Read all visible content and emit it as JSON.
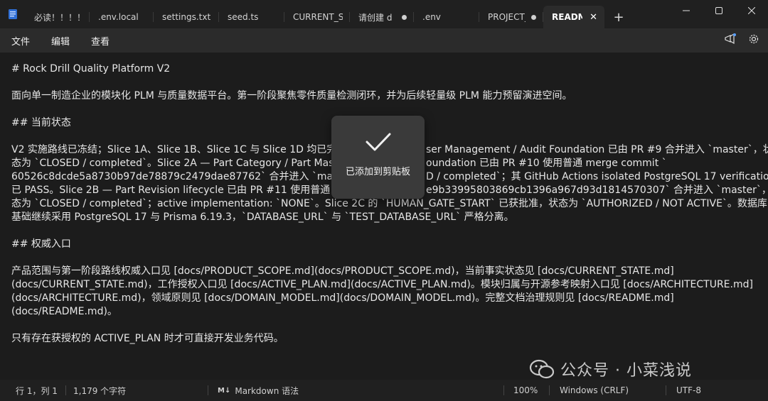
{
  "tabs": [
    {
      "label": "必读！！！！",
      "modified": false
    },
    {
      "label": ".env.local",
      "modified": false
    },
    {
      "label": "settings.txt",
      "modified": false
    },
    {
      "label": "seed.ts",
      "modified": false
    },
    {
      "label": "CURRENT_STAT",
      "modified": false
    },
    {
      "label": "请创建 d",
      "modified": true
    },
    {
      "label": ".env",
      "modified": false
    },
    {
      "label": "PROJECT_",
      "modified": true
    },
    {
      "label": "READMI",
      "active": true
    }
  ],
  "tab_close": "✕",
  "new_tab": "+",
  "menu": {
    "file": "文件",
    "edit": "编辑",
    "view": "查看"
  },
  "doc": {
    "lines": [
      "# Rock Drill Quality Platform V2",
      "",
      "面向单一制造企业的模块化 PLM 与质量数据平台。第一阶段聚焦零件质量检测闭环，并为后续轻量级 PLM 能力预留演进空间。",
      "",
      "## 当前状态",
      "",
      "V2 实施路线已冻结；Slice 1A、Slice 1B、Slice 1C 与 Slice 1D 均已完",
      "态为 `CLOSED / completed`。Slice 2A — Part Category / Part Mas",
      "60526c8dcde5a8730b97de78879c2479dae87762` 合并进入 `maste",
      "已 PASS。Slice 2B — Part Revision lifecycle 已由 PR #11 使用普通",
      "态为 `CLOSED / completed`；active implementation: `NONE`。Slice 2C 的 `HUMAN_GATE_START` 已获批准，状态为 `AUTHORIZED / NOT ACTIVE`。数据库",
      "基础继续采用 PostgreSQL 17 与 Prisma 6.19.3，`DATABASE_URL` 与 `TEST_DATABASE_URL` 严格分离。",
      "",
      "## 权威入口",
      "",
      "产品范围与第一阶段路线权威入口见 [docs/PRODUCT_SCOPE.md](docs/PRODUCT_SCOPE.md)，当前事实状态见 [docs/CURRENT_STATE.md]",
      "(docs/CURRENT_STATE.md)，工作授权入口见 [docs/ACTIVE_PLAN.md](docs/ACTIVE_PLAN.md)。模块归属与开源参考映射入口见 [docs/ARCHITECTURE.md]",
      "(docs/ARCHITECTURE.md)，领域原则见 [docs/DOMAIN_MODEL.md](docs/DOMAIN_MODEL.md)。完整文档治理规则见 [docs/README.md]",
      "(docs/README.md)。",
      "",
      "只有存在获授权的 ACTIVE_PLAN 时才可直接开发业务代码。"
    ],
    "overlay_fragments": [
      {
        "row": 6,
        "text": "ser Management / Audit Foundation 已由 PR #9 合并进入 `master`，状"
      },
      {
        "row": 7,
        "text": "oundation 已由 PR #10 使用普通 merge commit `"
      },
      {
        "row": 8,
        "text": "D / completed`；其 GitHub Actions isolated PostgreSQL 17 verification"
      },
      {
        "row": 9,
        "text": "e9b33995803869cb1396a967d93d1814570307` 合并进入 `master`，状"
      }
    ]
  },
  "toast": {
    "text": "已添加到剪贴板"
  },
  "watermark": {
    "text": "公众号 · 小菜浅说"
  },
  "status": {
    "position": "行 1，列 1",
    "chars": "1,179 个字符",
    "mode": "Markdown 语法",
    "zoom": "100%",
    "eol": "Windows (CRLF)",
    "encoding": "UTF-8"
  }
}
